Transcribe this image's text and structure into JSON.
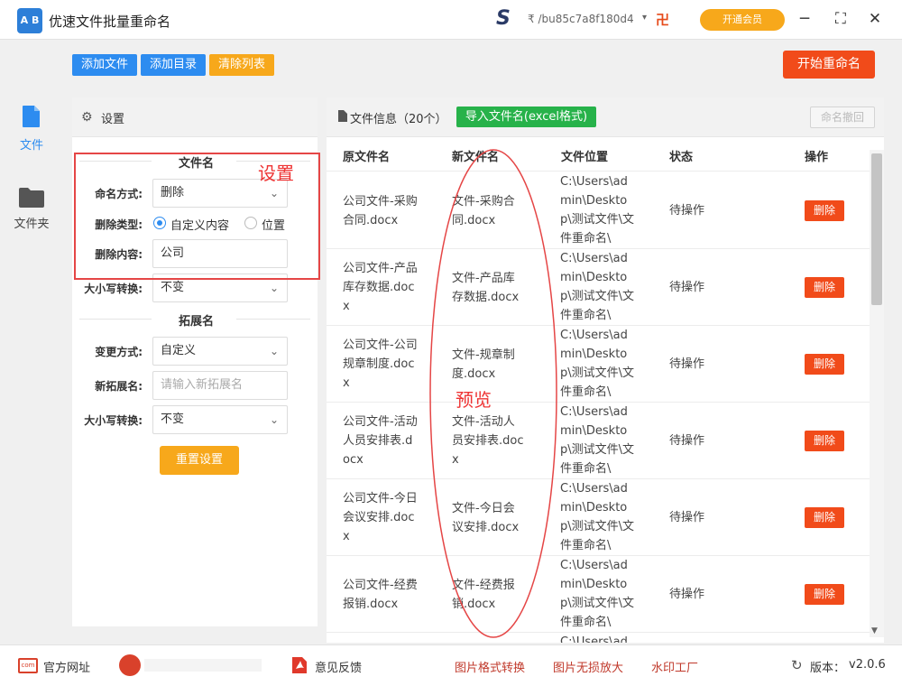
{
  "app": {
    "title": "优速文件批量重命名",
    "logo_text": "A B"
  },
  "user": {
    "id_text": "₹ /bu85c7a8f180d4",
    "vip_label": "开通会员"
  },
  "nav": [
    {
      "label": "文件",
      "icon": "file-icon",
      "active": true
    },
    {
      "label": "文件夹",
      "icon": "folder-icon",
      "active": false
    }
  ],
  "toolbar": {
    "add_file": "添加文件",
    "add_dir": "添加目录",
    "clear_list": "清除列表",
    "start_rename": "开始重命名"
  },
  "settings": {
    "title": "设置",
    "filename_section": "文件名",
    "naming_mode_label": "命名方式:",
    "naming_mode_value": "删除",
    "delete_type_label": "删除类型:",
    "delete_type_opt1": "自定义内容",
    "delete_type_opt2": "位置",
    "delete_content_label": "删除内容:",
    "delete_content_value": "公司",
    "case_label": "大小写转换:",
    "case_value": "不变",
    "ext_section": "拓展名",
    "change_mode_label": "变更方式:",
    "change_mode_value": "自定义",
    "new_ext_label": "新拓展名:",
    "new_ext_placeholder": "请输入新拓展名",
    "ext_case_label": "大小写转换:",
    "ext_case_value": "不变",
    "reset_label": "重置设置"
  },
  "annotations": {
    "settings": "设置",
    "preview": "预览"
  },
  "files": {
    "header_title": "文件信息（20个）",
    "import_label": "导入文件名(excel格式)",
    "undo_label": "命名撤回",
    "columns": [
      "原文件名",
      "新文件名",
      "文件位置",
      "状态",
      "操作"
    ],
    "rows": [
      {
        "orig": "公司文件-采购合同.docx",
        "new": "文件-采购合同.docx",
        "path": "C:\\Users\\admin\\Desktop\\测试文件\\文件重命名\\",
        "status": "待操作",
        "action": "删除"
      },
      {
        "orig": "公司文件-产品库存数据.docx",
        "new": "文件-产品库存数据.docx",
        "path": "C:\\Users\\admin\\Desktop\\测试文件\\文件重命名\\",
        "status": "待操作",
        "action": "删除"
      },
      {
        "orig": "公司文件-公司规章制度.docx",
        "new": "文件-规章制度.docx",
        "path": "C:\\Users\\admin\\Desktop\\测试文件\\文件重命名\\",
        "status": "待操作",
        "action": "删除"
      },
      {
        "orig": "公司文件-活动人员安排表.docx",
        "new": "文件-活动人员安排表.docx",
        "path": "C:\\Users\\admin\\Desktop\\测试文件\\文件重命名\\",
        "status": "待操作",
        "action": "删除"
      },
      {
        "orig": "公司文件-今日会议安排.docx",
        "new": "文件-今日会议安排.docx",
        "path": "C:\\Users\\admin\\Desktop\\测试文件\\文件重命名\\",
        "status": "待操作",
        "action": "删除"
      },
      {
        "orig": "公司文件-经费报销.docx",
        "new": "文件-经费报销.docx",
        "path": "C:\\Users\\admin\\Desktop\\测试文件\\文件重命名\\",
        "status": "待操作",
        "action": "删除"
      }
    ],
    "partial_row_path": "C:\\Users\\ad"
  },
  "footer": {
    "website": "官方网址",
    "feedback": "意见反馈",
    "link1": "图片格式转换",
    "link2": "图片无损放大",
    "link3": "水印工厂",
    "version_label": "版本：",
    "version": "v2.0.6"
  },
  "colors": {
    "accent_blue": "#2d8cf0",
    "orange": "#f7a81b",
    "red": "#f14b1a",
    "green": "#27b24a"
  }
}
